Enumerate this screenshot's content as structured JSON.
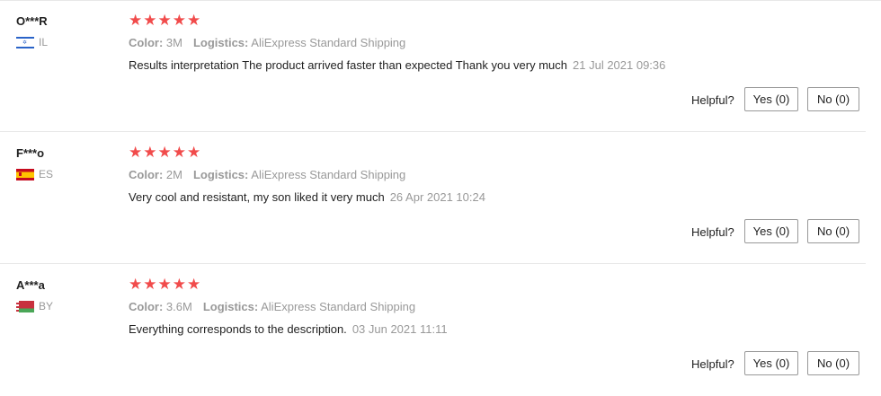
{
  "colors": {
    "star": "#f14b4b",
    "muted": "#999999",
    "text": "#222222"
  },
  "helpful_label": "Helpful?",
  "reviews": [
    {
      "name": "O***R",
      "country": "IL",
      "flag_icon": "israel-flag-icon",
      "stars": "★★★★★",
      "rating": 5,
      "color_label": "Color:",
      "color_value": "3M",
      "logistics_label": "Logistics:",
      "logistics_value": "AliExpress Standard Shipping",
      "text": "Results interpretation The product arrived faster than expected Thank you very much",
      "date": "21 Jul 2021 09:36",
      "yes_label": "Yes (0)",
      "no_label": "No (0)"
    },
    {
      "name": "F***o",
      "country": "ES",
      "flag_icon": "spain-flag-icon",
      "stars": "★★★★★",
      "rating": 5,
      "color_label": "Color:",
      "color_value": "2M",
      "logistics_label": "Logistics:",
      "logistics_value": "AliExpress Standard Shipping",
      "text": "Very cool and resistant, my son liked it very much",
      "date": "26 Apr 2021 10:24",
      "yes_label": "Yes (0)",
      "no_label": "No (0)"
    },
    {
      "name": "A***a",
      "country": "BY",
      "flag_icon": "belarus-flag-icon",
      "stars": "★★★★★",
      "rating": 5,
      "color_label": "Color:",
      "color_value": "3.6M",
      "logistics_label": "Logistics:",
      "logistics_value": "AliExpress Standard Shipping",
      "text": "Everything corresponds to the description.",
      "date": "03 Jun 2021 11:11",
      "yes_label": "Yes (0)",
      "no_label": "No (0)"
    }
  ]
}
